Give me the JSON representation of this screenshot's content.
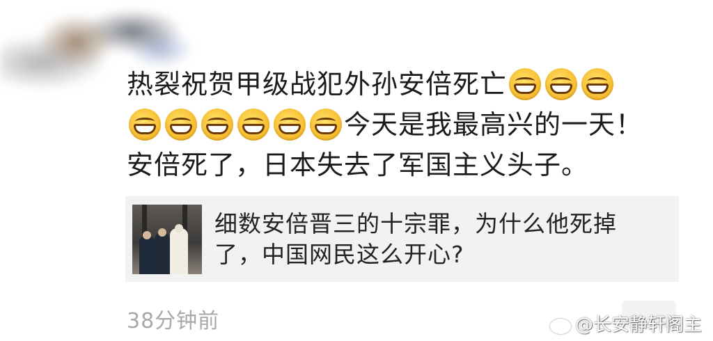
{
  "post": {
    "line1_text": "热裂祝贺甲级战犯外孙安倍死亡",
    "line2_text": "今天是我最高兴的一天！",
    "line3_text": "安倍死了，日本失去了军国主义头子。",
    "emoji_icon": "grinning-face-emoji",
    "line1_emoji_count": 3,
    "line2_emoji_count": 6
  },
  "link_card": {
    "title_line1": "细数安倍晋三的十宗罪，为什么他死掉",
    "title_line2": "了，中国网民这么开心?",
    "background": "#f2f2f2"
  },
  "meta": {
    "timestamp": "38分钟前",
    "timestamp_color": "#a8a8a8"
  },
  "watermark": {
    "text": "@长安静轩阁主",
    "icon": "weibo-icon"
  }
}
